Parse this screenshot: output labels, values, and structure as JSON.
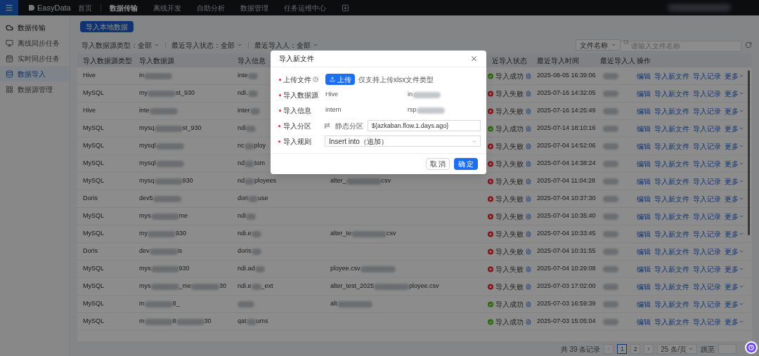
{
  "top_nav": {
    "logo": "EasyData",
    "home": "首页",
    "items": [
      {
        "label": "数据传输",
        "selected": true
      },
      {
        "label": "离线开发",
        "selected": false
      },
      {
        "label": "自助分析",
        "selected": false
      },
      {
        "label": "数据管理",
        "selected": false
      },
      {
        "label": "任务运维中心",
        "selected": false
      }
    ]
  },
  "sidebar": {
    "items": [
      {
        "label": "数据传输",
        "kind": "section",
        "selected": false
      },
      {
        "label": "离线同步任务",
        "kind": "offline",
        "selected": false
      },
      {
        "label": "实时同步任务",
        "kind": "realtime",
        "selected": false
      },
      {
        "label": "数据导入",
        "kind": "import",
        "selected": true
      },
      {
        "label": "数据源管理",
        "kind": "source",
        "selected": false
      }
    ]
  },
  "import_button": "导入本地数据",
  "filters": [
    {
      "label": "导入数据源类型：全部"
    },
    {
      "label": "最近导入状态：全部"
    },
    {
      "label": "最近导入人：全部"
    }
  ],
  "search": {
    "field_select": "文件名称",
    "placeholder": "请输入文件名称"
  },
  "table": {
    "columns": {
      "type": "导入数据源类型",
      "source": "导入数据源",
      "info": "导入信息",
      "status": "近导入状态",
      "time": "最近导入时间",
      "person": "最近导入人",
      "actions": "操作"
    },
    "rows": [
      {
        "type": "Hive",
        "source": [
          "in"
        ],
        "info": [
          "inte"
        ],
        "file": [],
        "status": {
          "label": "导入成功",
          "kind": "success"
        },
        "time": "2025-08-05 16:39:06",
        "actions": [
          "编辑",
          "导入新文件",
          "导入记录",
          "更多"
        ]
      },
      {
        "type": "MySQL",
        "source": [
          "my",
          "st_930"
        ],
        "info": [
          "ndi."
        ],
        "file": [],
        "status": {
          "label": "导入失败",
          "kind": "failure"
        },
        "time": "2025-07-16 14:32:05",
        "actions": [
          "编辑",
          "导入新文件",
          "导入记录",
          "更多"
        ]
      },
      {
        "type": "Hive",
        "source": [
          "inte"
        ],
        "info": [
          "inter"
        ],
        "file": [],
        "status": {
          "label": "导入失败",
          "kind": "failure"
        },
        "time": "2025-07-16 14:25:49",
        "actions": [
          "编辑",
          "导入新文件",
          "导入记录",
          "更多"
        ]
      },
      {
        "type": "MySQL",
        "source": [
          "mysq",
          "st_930"
        ],
        "info": [
          "ndi"
        ],
        "file": [],
        "status": {
          "label": "导入成功",
          "kind": "success"
        },
        "time": "2025-07-14 18:10:16",
        "actions": [
          "编辑",
          "导入新文件",
          "导入记录",
          "更多"
        ]
      },
      {
        "type": "MySQL",
        "source": [
          "mysql"
        ],
        "info": [
          "nc",
          "ploy"
        ],
        "file": [],
        "status": {
          "label": "导入失败",
          "kind": "failure"
        },
        "time": "2025-07-04 14:52:06",
        "actions": [
          "编辑",
          "导入新文件",
          "导入记录",
          "更多"
        ]
      },
      {
        "type": "MySQL",
        "source": [
          "mysql"
        ],
        "info": [
          "nd",
          "tom"
        ],
        "file": [],
        "status": {
          "label": "导入失败",
          "kind": "failure"
        },
        "time": "2025-07-04 14:38:24",
        "actions": [
          "编辑",
          "导入新文件",
          "导入记录",
          "更多"
        ]
      },
      {
        "type": "MySQL",
        "source": [
          "mysq",
          "930"
        ],
        "info": [
          "nd",
          "ployees"
        ],
        "file": [
          "alter_",
          "csv"
        ],
        "status": {
          "label": "导入失败",
          "kind": "failure"
        },
        "time": "2025-07-04 11:04:28",
        "actions": [
          "编辑",
          "导入新文件",
          "导入记录",
          "更多"
        ]
      },
      {
        "type": "Doris",
        "source": [
          "dev5"
        ],
        "info": [
          "dori",
          "use"
        ],
        "file": [],
        "status": {
          "label": "导入失败",
          "kind": "failure"
        },
        "time": "2025-07-04 10:37:30",
        "actions": [
          "编辑",
          "导入新文件",
          "导入记录",
          "更多"
        ]
      },
      {
        "type": "MySQL",
        "source": [
          "mys",
          "me"
        ],
        "info": [
          "ndi"
        ],
        "file": [],
        "status": {
          "label": "导入失败",
          "kind": "failure"
        },
        "time": "2025-07-04 10:35:40",
        "actions": [
          "编辑",
          "导入新文件",
          "导入记录",
          "更多"
        ]
      },
      {
        "type": "MySQL",
        "source": [
          "my",
          "930"
        ],
        "info": [
          "ndi.e"
        ],
        "file": [
          "alter_te",
          "csv"
        ],
        "status": {
          "label": "导入失败",
          "kind": "failure"
        },
        "time": "2025-07-04 10:33:45",
        "actions": [
          "编辑",
          "导入新文件",
          "导入记录",
          "更多"
        ]
      },
      {
        "type": "Doris",
        "source": [
          "dev",
          "is"
        ],
        "info": [
          "doris"
        ],
        "file": [],
        "status": {
          "label": "导入失败",
          "kind": "failure"
        },
        "time": "2025-07-04 10:31:55",
        "actions": [
          "编辑",
          "导入新文件",
          "导入记录",
          "更多"
        ]
      },
      {
        "type": "MySQL",
        "source": [
          "mys",
          "930"
        ],
        "info": [
          "ndi.ad"
        ],
        "file": [
          "ployee.csv"
        ],
        "status": {
          "label": "导入失败",
          "kind": "failure"
        },
        "time": "2025-07-04 10:29:08",
        "actions": [
          "编辑",
          "导入新文件",
          "导入记录",
          "更多"
        ]
      },
      {
        "type": "MySQL",
        "source": [
          "mys",
          "_me",
          "30"
        ],
        "info": [
          "ndi.e",
          "_ext"
        ],
        "file": [
          "alter_test_2025",
          "ployee.csv"
        ],
        "status": {
          "label": "导入失败",
          "kind": "failure"
        },
        "time": "2025-07-03 17:02:00",
        "actions": [
          "编辑",
          "导入新文件",
          "导入记录",
          "更多"
        ]
      },
      {
        "type": "MySQL",
        "source": [
          "m",
          "8_"
        ],
        "info": [],
        "file": [
          "alt"
        ],
        "status": {
          "label": "导入成功",
          "kind": "success"
        },
        "time": "2025-07-03 16:59:39",
        "actions": [
          "编辑",
          "导入新文件",
          "导入记录",
          "更多"
        ]
      },
      {
        "type": "MySQL",
        "source": [
          "m",
          "8",
          "30"
        ],
        "info": [
          "qat",
          "ums"
        ],
        "file": [],
        "status": {
          "label": "导入成功",
          "kind": "success"
        },
        "time": "2025-07-03 15:05:04",
        "actions": [
          "编辑",
          "导入新文件",
          "导入记录",
          "更多"
        ]
      }
    ]
  },
  "pagination": {
    "total": "共 39 条记录",
    "pages": [
      {
        "label": "1",
        "selected": true
      },
      {
        "label": "2",
        "selected": false
      }
    ],
    "page_size": "25 条/页",
    "jump_label": "跳至"
  },
  "dialog": {
    "title": "导入新文件",
    "fields": [
      {
        "kind": "upload",
        "label": "上传文件",
        "required": true,
        "button": "上传",
        "hint": "仅支持上传xlsx文件类型"
      },
      {
        "kind": "pair",
        "label": "导入数据源",
        "required": true,
        "value": "Hive",
        "extra": [
          "in"
        ]
      },
      {
        "kind": "pair",
        "label": "导入信息",
        "required": true,
        "value": "intern",
        "extra": [
          "rsp"
        ]
      },
      {
        "kind": "partition",
        "label": "导入分区",
        "required": true,
        "key": "pt",
        "type": "静态分区",
        "value": "${azkaban.flow.1.days.ago}"
      },
      {
        "kind": "select",
        "label": "导入规则",
        "required": true,
        "value": "Insert into（追加）"
      }
    ],
    "buttons": [
      {
        "label": "取 消",
        "kind": "secondary"
      },
      {
        "label": "确 定",
        "kind": "primary"
      }
    ]
  }
}
